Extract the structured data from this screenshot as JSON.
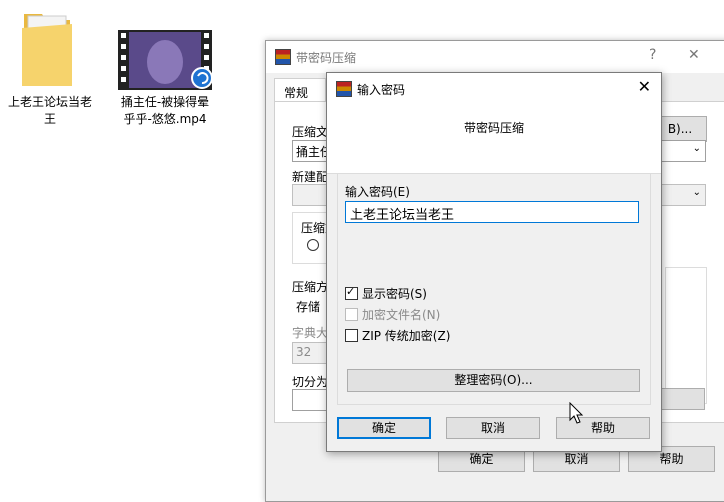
{
  "desktop": {
    "icons": [
      {
        "label_line1": "上老王论坛当老",
        "label_line2": "王",
        "icon": "folder-icon"
      },
      {
        "label_line1": "捅主任-被操得晕",
        "label_line2": "乎乎-悠悠.mp4",
        "icon": "video-file-icon"
      }
    ]
  },
  "back_dialog": {
    "title": "带密码压缩",
    "help_glyph": "?",
    "close_glyph": "✕",
    "tab_general": "常规",
    "browse_label": "B)...",
    "archive_name_label": "压缩文",
    "archive_name_value": "捅主任",
    "profile_label": "新建配",
    "format_label": "压缩文",
    "method_label": "压缩方",
    "method_value": "存储",
    "dict_label": "字典大",
    "dict_value": "32",
    "split_label": "切分为",
    "ok": "确定",
    "cancel": "取消",
    "help": "帮助"
  },
  "password_dialog": {
    "title": "输入密码",
    "header": "带密码压缩",
    "password_label": "输入密码(E)",
    "password_value": "上老王论坛当老王",
    "show_password": "显示密码(S)",
    "show_password_checked": true,
    "encrypt_filenames": "加密文件名(N)",
    "encrypt_filenames_checked": false,
    "zip_legacy": "ZIP 传统加密(Z)",
    "zip_legacy_checked": false,
    "organize_button": "整理密码(O)...",
    "ok": "确定",
    "cancel": "取消",
    "help": "帮助"
  },
  "colors": {
    "accent": "#0078d7",
    "dialog_bg": "#f0f0f0"
  }
}
